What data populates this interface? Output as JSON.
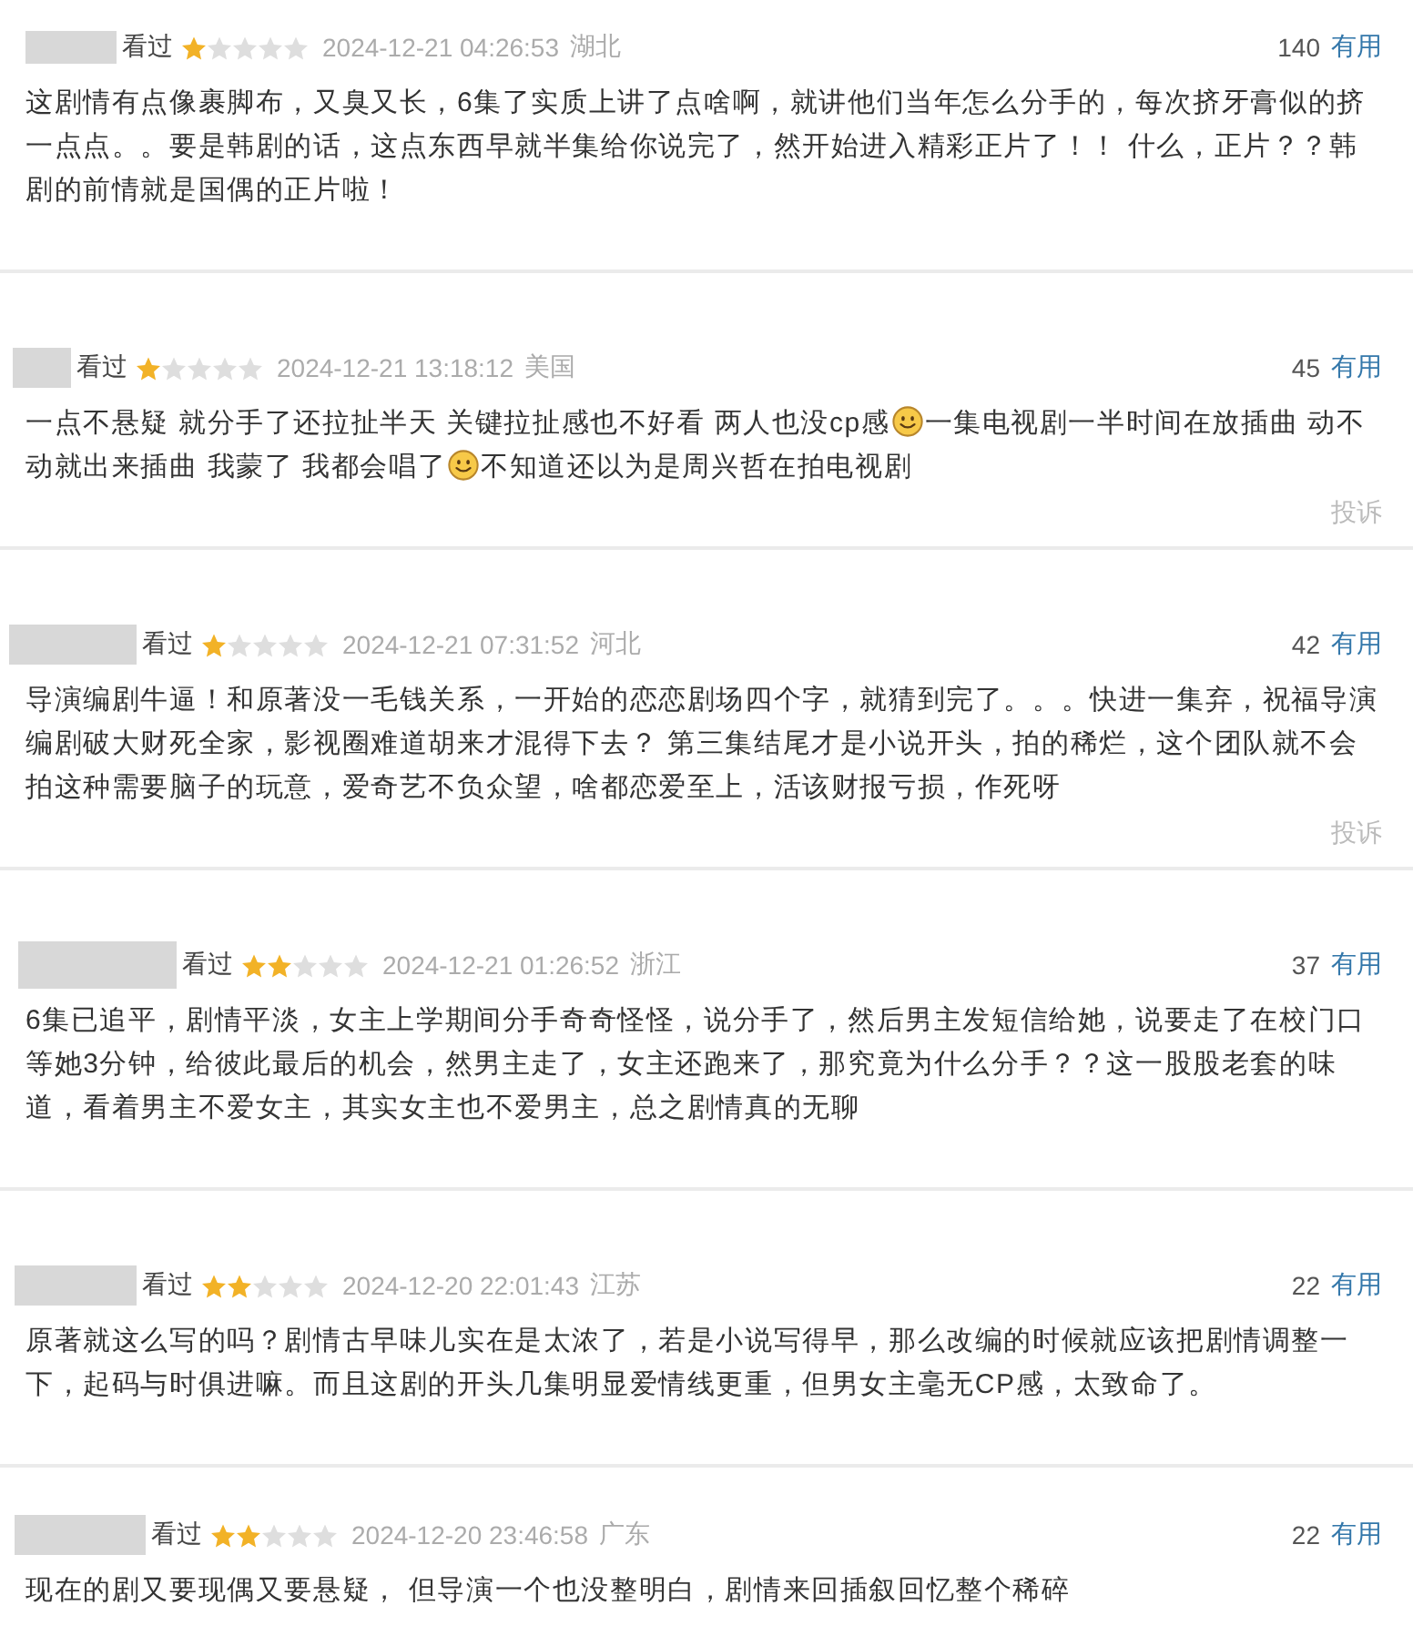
{
  "reviews": [
    {
      "status": "看过",
      "stars": 1,
      "time": "2024-12-21 04:26:53",
      "location": "湖北",
      "useful_count": "140",
      "useful_label": "有用",
      "body": [
        {
          "kind": "text",
          "text": "这剧情有点像裹脚布，又臭又长，6集了实质上讲了点啥啊，就讲他们当年怎么分手的，每次挤牙膏似的挤一点点。。要是韩剧的话，这点东西早就半集给你说完了，然开始进入精彩正片了！！ 什么，正片？？韩剧的前情就是国偶的正片啦！"
        }
      ]
    },
    {
      "status": "看过",
      "stars": 1,
      "time": "2024-12-21 13:18:12",
      "location": "美国",
      "useful_count": "45",
      "useful_label": "有用",
      "body": [
        {
          "kind": "text",
          "text": "一点不悬疑 就分手了还拉扯半天 关键拉扯感也不好看 两人也没cp感"
        },
        {
          "kind": "emoji"
        },
        {
          "kind": "text",
          "text": "一集电视剧一半时间在放插曲 动不动就出来插曲 我蒙了 我都会唱了"
        },
        {
          "kind": "emoji"
        },
        {
          "kind": "text",
          "text": "不知道还以为是周兴哲在拍电视剧"
        }
      ],
      "report": "投诉"
    },
    {
      "status": "看过",
      "stars": 1,
      "time": "2024-12-21 07:31:52",
      "location": "河北",
      "useful_count": "42",
      "useful_label": "有用",
      "body": [
        {
          "kind": "text",
          "text": "导演编剧牛逼！和原著没一毛钱关系，一开始的恋恋剧场四个字，就猜到完了。。。快进一集弃，祝福导演编剧破大财死全家，影视圈难道胡来才混得下去？ 第三集结尾才是小说开头，拍的稀烂，这个团队就不会拍这种需要脑子的玩意，爱奇艺不负众望，啥都恋爱至上，活该财报亏损，作死呀"
        }
      ],
      "report": "投诉"
    },
    {
      "status": "看过",
      "stars": 2,
      "time": "2024-12-21 01:26:52",
      "location": "浙江",
      "useful_count": "37",
      "useful_label": "有用",
      "body": [
        {
          "kind": "text",
          "text": "6集已追平，剧情平淡，女主上学期间分手奇奇怪怪，说分手了，然后男主发短信给她，说要走了在校门口等她3分钟，给彼此最后的机会，然男主走了，女主还跑来了，那究竟为什么分手？？这一股股老套的味道，看着男主不爱女主，其实女主也不爱男主，总之剧情真的无聊"
        }
      ]
    },
    {
      "status": "看过",
      "stars": 2,
      "time": "2024-12-20 22:01:43",
      "location": "江苏",
      "useful_count": "22",
      "useful_label": "有用",
      "body": [
        {
          "kind": "text",
          "text": "原著就这么写的吗？剧情古早味儿实在是太浓了，若是小说写得早，那么改编的时候就应该把剧情调整一下，起码与时俱进嘛。而且这剧的开头几集明显爱情线更重，但男女主毫无CP感，太致命了。"
        }
      ]
    },
    {
      "status": "看过",
      "stars": 2,
      "time": "2024-12-20 23:46:58",
      "location": "广东",
      "useful_count": "22",
      "useful_label": "有用",
      "body": [
        {
          "kind": "text",
          "text": "现在的剧又要现偶又要悬疑， 但导演一个也没整明白，剧情来回插叙回忆整个稀碎"
        }
      ]
    }
  ]
}
